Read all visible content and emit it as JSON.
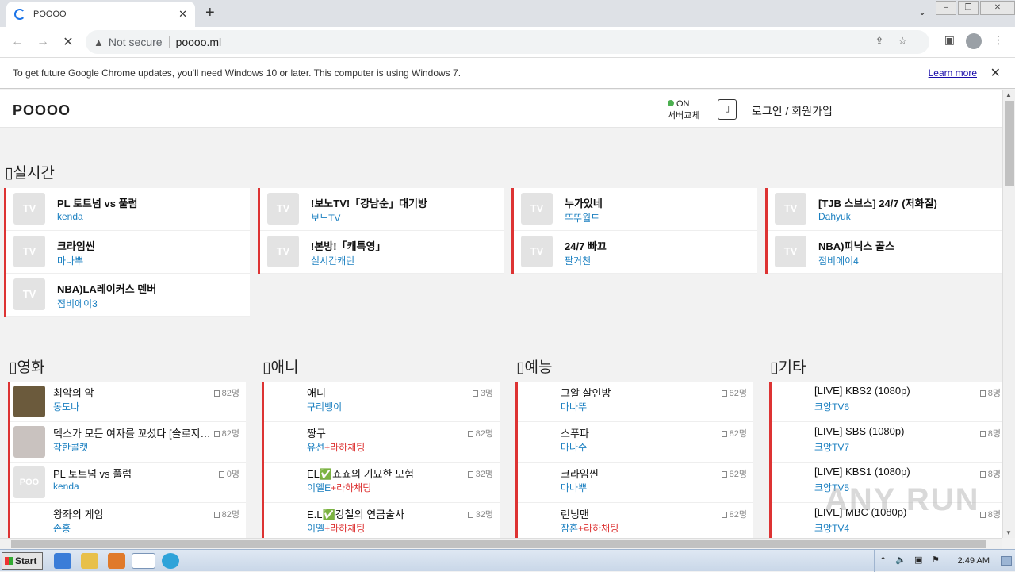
{
  "browser": {
    "tab_title": "POOOO",
    "url_security": "Not secure",
    "url": "poooo.ml",
    "infobar_text": "To get future Google Chrome updates, you'll need Windows 10 or later. This computer is using Windows 7.",
    "infobar_link": "Learn more"
  },
  "site": {
    "logo": "POOOO",
    "server_status": "ON",
    "server_change": "서버교체",
    "login": "로그인 / 회원가입"
  },
  "live_section": {
    "title": "실시간",
    "thumb_label": "TV",
    "columns": [
      [
        {
          "title": "PL 토트넘 vs 풀럼",
          "sub": "kenda"
        },
        {
          "title": "크라임씬",
          "sub": "마나뿌"
        },
        {
          "title": "NBA)LA레이커스 덴버",
          "sub": "점비에이3"
        }
      ],
      [
        {
          "title": "!보노TV!「강남순」대기방",
          "sub": "보노TV"
        },
        {
          "title": "!본방!「캐특영」",
          "sub": "실시간캐린"
        }
      ],
      [
        {
          "title": "누가있네",
          "sub": "뚜뚜월드"
        },
        {
          "title": "24/7 빠끄",
          "sub": "팔거천"
        }
      ],
      [
        {
          "title": "[TJB 스브스] 24/7 (저화질)",
          "sub": "Dahyuk"
        },
        {
          "title": "NBA)피닉스 골스",
          "sub": "점비에이4"
        }
      ]
    ]
  },
  "categories": [
    {
      "title": "영화",
      "items": [
        {
          "title": "최악의 악",
          "sub": "동도나",
          "extra": "",
          "views": "82명",
          "img": "photo-a"
        },
        {
          "title": "덱스가 모든 여자를 꼬셨다 [솔로지옥]",
          "sub": "착한콜캣",
          "extra": "",
          "views": "82명",
          "img": "photo-b"
        },
        {
          "title": "PL 토트넘 vs 풀럼",
          "sub": "kenda",
          "extra": "",
          "views": "0명",
          "img": "poo"
        },
        {
          "title": "왕좌의 게임",
          "sub": "손홍",
          "extra": "",
          "views": "82명",
          "img": ""
        }
      ]
    },
    {
      "title": "애니",
      "items": [
        {
          "title": "애니",
          "sub": "구리뱅이",
          "extra": "",
          "views": "3명",
          "img": ""
        },
        {
          "title": "짱구",
          "sub": "유선",
          "extra": "+라하채팅",
          "views": "82명",
          "img": ""
        },
        {
          "title": "EL✅죠죠의 기묘한 모험",
          "sub": "이엘E",
          "extra": "+라하채팅",
          "views": "32명",
          "img": ""
        },
        {
          "title": "E.L✅강철의 연금술사",
          "sub": "이엘",
          "extra": "+라하채팅",
          "views": "32명",
          "img": ""
        }
      ]
    },
    {
      "title": "예능",
      "items": [
        {
          "title": "그알 살인방",
          "sub": "마나뚜",
          "extra": "",
          "views": "82명",
          "img": ""
        },
        {
          "title": "스푸파",
          "sub": "마나수",
          "extra": "",
          "views": "82명",
          "img": ""
        },
        {
          "title": "크라임씬",
          "sub": "마나뿌",
          "extra": "",
          "views": "82명",
          "img": ""
        },
        {
          "title": "런닝맨",
          "sub": "잠혼",
          "extra": "+라하채팅",
          "views": "82명",
          "img": ""
        }
      ]
    },
    {
      "title": "기타",
      "items": [
        {
          "title": "[LIVE] KBS2 (1080p)",
          "sub": "크앙TV6",
          "extra": "",
          "views": "8명",
          "img": ""
        },
        {
          "title": "[LIVE] SBS (1080p)",
          "sub": "크앙TV7",
          "extra": "",
          "views": "8명",
          "img": ""
        },
        {
          "title": "[LIVE] KBS1 (1080p)",
          "sub": "크앙TV5",
          "extra": "",
          "views": "8명",
          "img": ""
        },
        {
          "title": "[LIVE] MBC (1080p)",
          "sub": "크앙TV4",
          "extra": "",
          "views": "8명",
          "img": ""
        }
      ]
    }
  ],
  "taskbar": {
    "start": "Start",
    "clock": "2:49 AM"
  },
  "watermark": "ANY RUN"
}
